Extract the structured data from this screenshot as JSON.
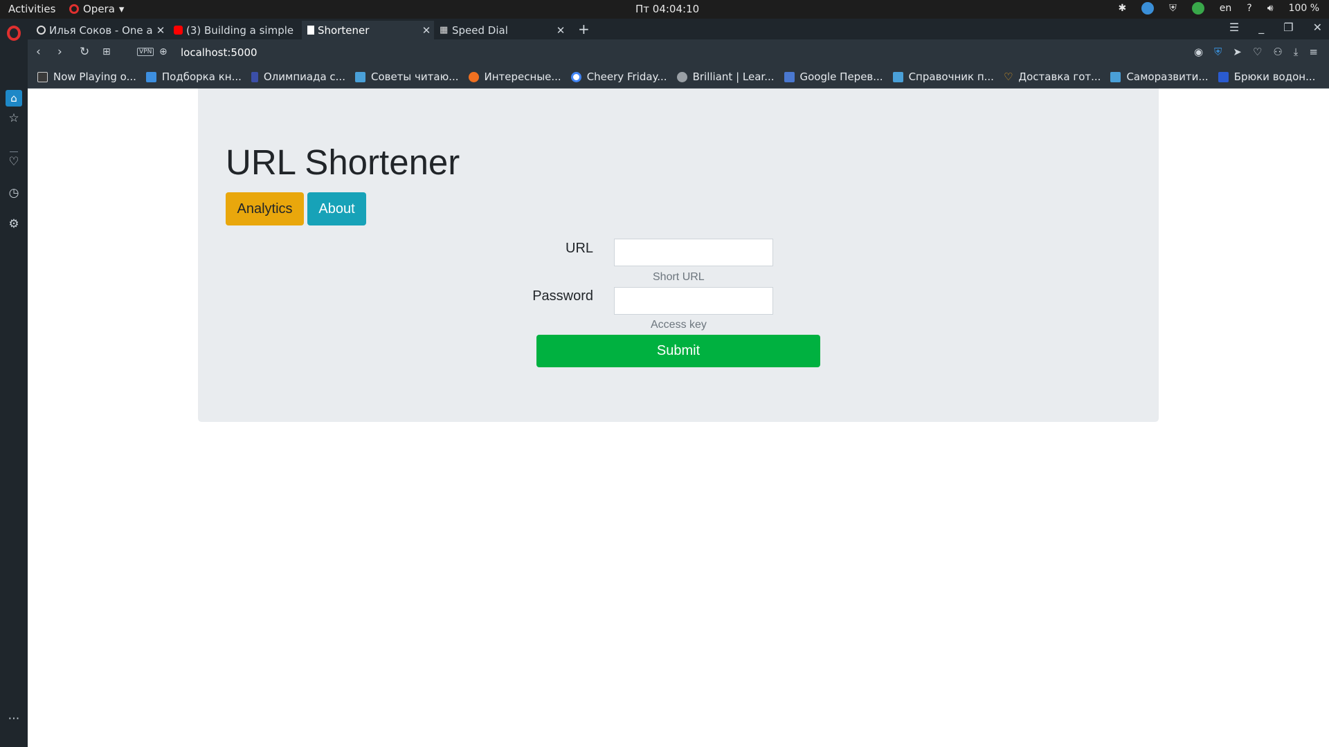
{
  "os_topbar": {
    "activities": "Activities",
    "app_name": "Opera",
    "clock": "Пт 04:04:10",
    "lang": "en",
    "help": "?",
    "battery": "100 %"
  },
  "tabs": [
    {
      "title": "Илья Соков - One ac",
      "favicon_color": "#ffffff"
    },
    {
      "title": "(3) Building a simple",
      "favicon_color": "#ff0000"
    },
    {
      "title": "Shortener",
      "favicon_color": "#ffffff"
    },
    {
      "title": "Speed Dial",
      "favicon_color": "#ffffff"
    }
  ],
  "addressbar": {
    "vpn": "VPN",
    "url": "localhost:5000"
  },
  "bookmarks": [
    {
      "label": "Now Playing o...",
      "color": "#3a3a3a"
    },
    {
      "label": "Подборка кн...",
      "color": "#3d8fe0"
    },
    {
      "label": "Олимпиада с...",
      "color": "#3b4fa8"
    },
    {
      "label": "Советы читаю...",
      "color": "#4aa0d8"
    },
    {
      "label": "Интересные...",
      "color": "#f07020"
    },
    {
      "label": "Cheery Friday...",
      "color": "#4285f4"
    },
    {
      "label": "Brilliant | Lear...",
      "color": "#9aa0a6"
    },
    {
      "label": "Google Перев...",
      "color": "#4a78d0"
    },
    {
      "label": "Справочник п...",
      "color": "#4aa0d8"
    },
    {
      "label": "Доставка гот...",
      "color": "#e8a020"
    },
    {
      "label": "Саморазвити...",
      "color": "#4aa0d8"
    },
    {
      "label": "Брюки водон...",
      "color": "#2a5bd0"
    }
  ],
  "page": {
    "title": "URL Shortener",
    "analytics_button": "Analytics",
    "about_button": "About",
    "url_label": "URL",
    "url_value": "",
    "url_help": "Short URL",
    "password_label": "Password",
    "password_value": "",
    "password_help": "Access key",
    "submit_button": "Submit"
  },
  "colors": {
    "analytics": "#e9a70c",
    "about": "#17a2b8",
    "submit": "#00b140",
    "jumbotron": "#e9ecef"
  }
}
